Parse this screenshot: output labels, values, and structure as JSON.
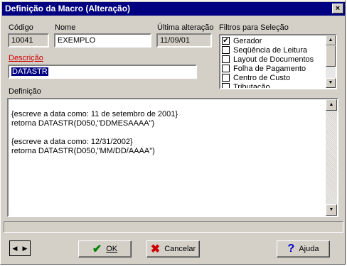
{
  "window": {
    "title": "Definição da Macro (Alteração)",
    "close_glyph": "×"
  },
  "codigo": {
    "label": "Código",
    "value": "10041"
  },
  "nome": {
    "label": "Nome",
    "value": "EXEMPLO"
  },
  "ultima": {
    "label": "Última alteração",
    "value": "11/09/01"
  },
  "descricao": {
    "label": "Descrição",
    "value": "DATASTR",
    "label_color": "#cc0000"
  },
  "filtros": {
    "label": "Filtros para Seleção",
    "items": [
      {
        "label": "Gerador",
        "checked": true
      },
      {
        "label": "Seqüência de Leitura",
        "checked": false
      },
      {
        "label": "Layout de Documentos",
        "checked": false
      },
      {
        "label": "Folha de Pagamento",
        "checked": false
      },
      {
        "label": "Centro de Custo",
        "checked": false
      },
      {
        "label": "Tributação",
        "checked": false
      }
    ]
  },
  "definicao": {
    "label": "Definição",
    "lines": [
      "{escreve a data como: 11 de setembro de 2001}",
      "retorna DATASTR(D050,\"DDMESAAAA\")",
      "",
      "{escreve a data como: 12/31/2002}",
      "retorna DATASTR(D050,\"MM/DD/AAAA\")"
    ]
  },
  "buttons": {
    "ok": {
      "label": "OK",
      "icon": "check-icon",
      "color": "#008000"
    },
    "cancelar": {
      "label": "Cancelar",
      "icon": "x-icon",
      "color": "#cc0000"
    },
    "ajuda": {
      "label": "Ajuda",
      "icon": "question-icon",
      "color": "#0000cc"
    }
  }
}
